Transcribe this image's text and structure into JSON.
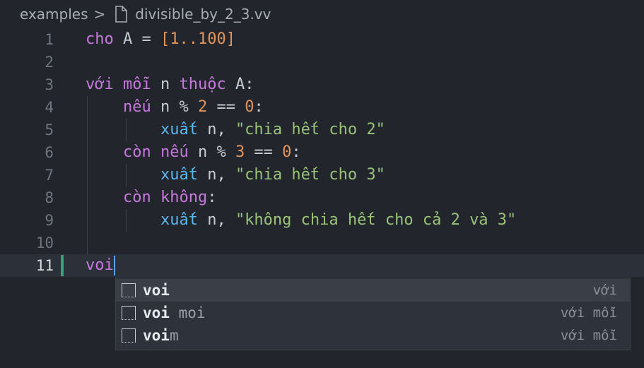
{
  "breadcrumb": {
    "folder": "examples",
    "separator": ">",
    "file": "divisible_by_2_3.vv"
  },
  "editor": {
    "line_numbers": [
      "1",
      "2",
      "3",
      "4",
      "5",
      "6",
      "7",
      "8",
      "9",
      "10",
      "11"
    ],
    "current_line": "11",
    "lines": [
      {
        "tokens": [
          [
            "kw",
            "cho"
          ],
          [
            "op",
            " A = "
          ],
          [
            "num",
            "[1..100]"
          ]
        ]
      },
      {
        "tokens": []
      },
      {
        "tokens": [
          [
            "kw",
            "với mỗi"
          ],
          [
            "op",
            " n "
          ],
          [
            "kw",
            "thuộc"
          ],
          [
            "op",
            " A:"
          ]
        ]
      },
      {
        "tokens": [
          [
            "op",
            "    "
          ],
          [
            "kw",
            "nếu"
          ],
          [
            "op",
            " n % "
          ],
          [
            "num",
            "2"
          ],
          [
            "op",
            " == "
          ],
          [
            "num",
            "0"
          ],
          [
            "op",
            ":"
          ]
        ]
      },
      {
        "tokens": [
          [
            "op",
            "        "
          ],
          [
            "fn",
            "xuất"
          ],
          [
            "op",
            " n, "
          ],
          [
            "str",
            "\"chia hết cho 2\""
          ]
        ]
      },
      {
        "tokens": [
          [
            "op",
            "    "
          ],
          [
            "kw",
            "còn nếu"
          ],
          [
            "op",
            " n % "
          ],
          [
            "num",
            "3"
          ],
          [
            "op",
            " == "
          ],
          [
            "num",
            "0"
          ],
          [
            "op",
            ":"
          ]
        ]
      },
      {
        "tokens": [
          [
            "op",
            "        "
          ],
          [
            "fn",
            "xuất"
          ],
          [
            "op",
            " n, "
          ],
          [
            "str",
            "\"chia hết cho 3\""
          ]
        ]
      },
      {
        "tokens": [
          [
            "op",
            "    "
          ],
          [
            "kw",
            "còn không"
          ],
          [
            "op",
            ":"
          ]
        ]
      },
      {
        "tokens": [
          [
            "op",
            "        "
          ],
          [
            "fn",
            "xuất"
          ],
          [
            "op",
            " n, "
          ],
          [
            "str",
            "\"không chia hết cho cả 2 và 3\""
          ]
        ]
      },
      {
        "tokens": []
      },
      {
        "tokens": [
          [
            "kw",
            "voi"
          ]
        ]
      }
    ]
  },
  "suggestions": [
    {
      "match": "voi",
      "rest": "",
      "detail": "với",
      "selected": true
    },
    {
      "match": "voi",
      "rest": " moi",
      "detail": "với mỗi",
      "selected": false
    },
    {
      "match": "voi",
      "rest": "m",
      "detail": "với mỗi",
      "selected": false
    }
  ],
  "colors": {
    "background": "#22252b",
    "keyword": "#c678dd",
    "number": "#e0955e",
    "function": "#5bb6f0",
    "string": "#98c379",
    "modified_marker": "#2ea87a"
  },
  "icons": {
    "breadcrumb_file": "file-icon",
    "suggestion_kind": "snippet-icon"
  }
}
